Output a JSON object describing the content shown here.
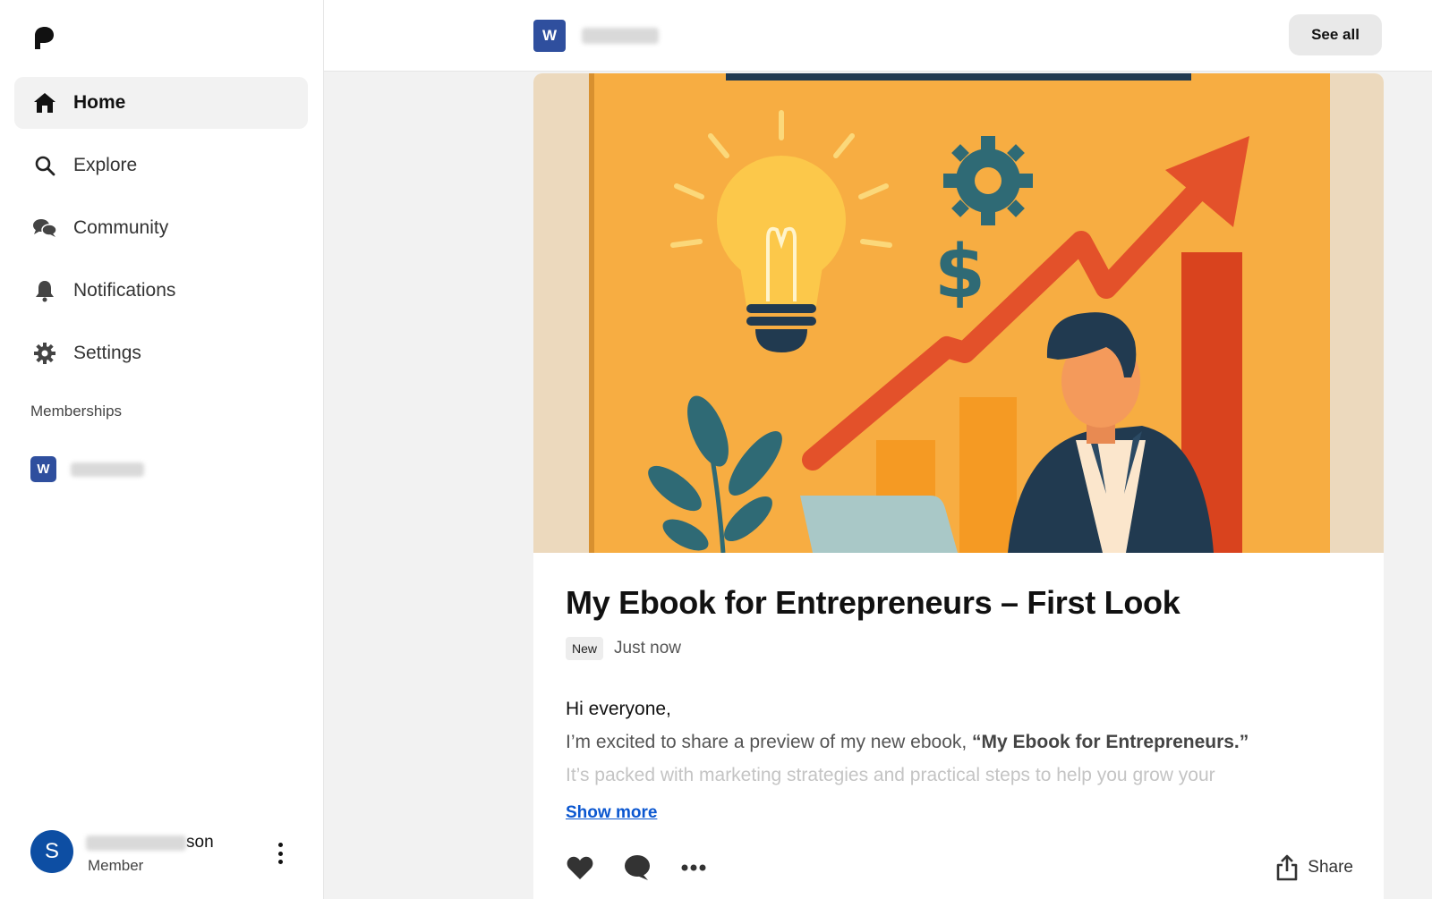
{
  "sidebar": {
    "items": [
      {
        "label": "Home",
        "icon": "home-icon",
        "active": true
      },
      {
        "label": "Explore",
        "icon": "search-icon",
        "active": false
      },
      {
        "label": "Community",
        "icon": "chat-icon",
        "active": false
      },
      {
        "label": "Notifications",
        "icon": "bell-icon",
        "active": false
      },
      {
        "label": "Settings",
        "icon": "gear-icon",
        "active": false
      }
    ],
    "memberships_label": "Memberships",
    "membership_badge": "W",
    "user": {
      "avatar_letter": "S",
      "name_visible_suffix": "son",
      "role": "Member"
    }
  },
  "topbar": {
    "creator_badge": "W",
    "see_all_label": "See all"
  },
  "post": {
    "title": "My Ebook for Entrepreneurs – First Look",
    "badge": "New",
    "time": "Just now",
    "greeting": "Hi everyone,",
    "line2_start": "I’m excited to share a preview of my new ebook, ",
    "line2_bold": "“My Ebook for Entrepreneurs.”",
    "line3": "It’s packed with marketing strategies and practical steps to help you grow your",
    "show_more": "Show more",
    "share_label": "Share"
  },
  "colors": {
    "accent_blue": "#0b57d0",
    "avatar_blue": "#0d4ea3",
    "badge_blue": "#2f4f9e",
    "hero_orange": "#f7ad42"
  }
}
